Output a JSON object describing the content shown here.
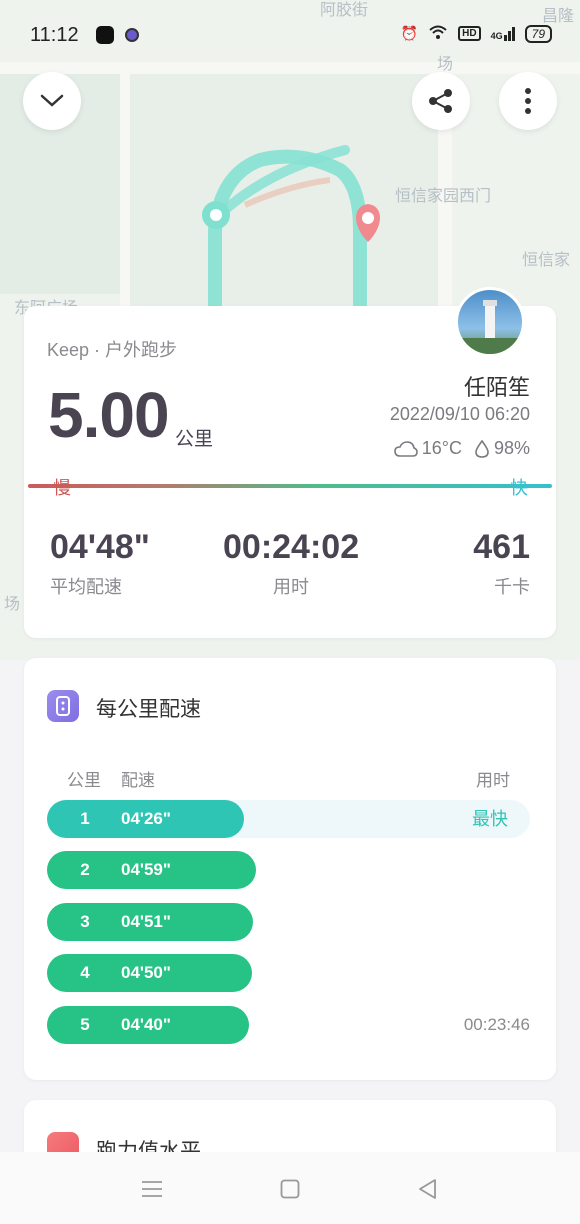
{
  "status_bar": {
    "time": "11:12",
    "network": "4G",
    "hd": "HD",
    "battery": "79"
  },
  "map": {
    "labels": [
      "阿胶街",
      "昌隆",
      "场",
      "恒信家园西门",
      "恒信家",
      "东阿广场",
      "场"
    ]
  },
  "summary": {
    "source": "Keep · 户外跑步",
    "distance": "5.00",
    "distance_unit": "公里",
    "username": "任陌笙",
    "datetime": "2022/09/10 06:20",
    "temperature": "16°C",
    "humidity": "98%",
    "slow_label": "慢",
    "fast_label": "快",
    "stats": [
      {
        "value": "04'48\"",
        "label": "平均配速"
      },
      {
        "value": "00:24:02",
        "label": "用时"
      },
      {
        "value": "461",
        "label": "千卡"
      }
    ]
  },
  "splits": {
    "title": "每公里配速",
    "headers": {
      "km": "公里",
      "pace": "配速",
      "time": "用时"
    },
    "fastest_label": "最快",
    "rows": [
      {
        "km": "1",
        "pace": "04'26\"",
        "fill": 0.408,
        "color": "#2ec5b5",
        "note": "最快",
        "time": ""
      },
      {
        "km": "2",
        "pace": "04'59\"",
        "fill": 0.432,
        "color": "#27c286",
        "note": "",
        "time": ""
      },
      {
        "km": "3",
        "pace": "04'51\"",
        "fill": 0.426,
        "color": "#27c286",
        "note": "",
        "time": ""
      },
      {
        "km": "4",
        "pace": "04'50\"",
        "fill": 0.424,
        "color": "#27c286",
        "note": "",
        "time": ""
      },
      {
        "km": "5",
        "pace": "04'40\"",
        "fill": 0.418,
        "color": "#27c286",
        "note": "",
        "time": "00:23:46"
      }
    ]
  },
  "next_section": {
    "title": "跑力值水平"
  },
  "colors": {
    "accent_teal": "#2ec5b5",
    "accent_green": "#27c286",
    "slow_red": "#d05656",
    "fast_cyan": "#35c0cf"
  }
}
